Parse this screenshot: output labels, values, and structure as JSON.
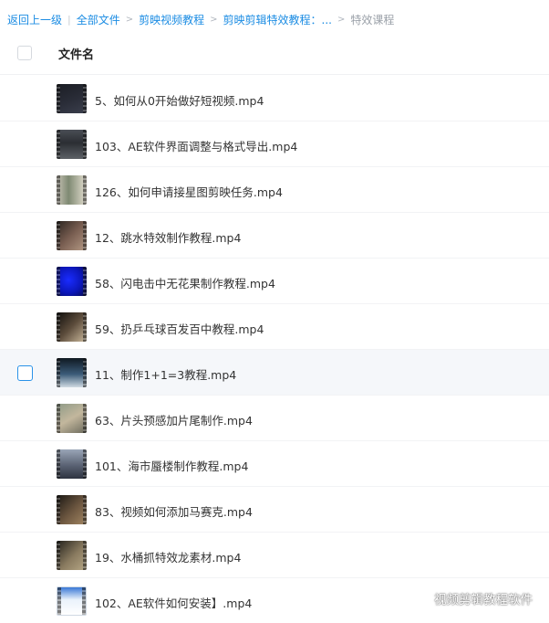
{
  "breadcrumb": {
    "back": "返回上一级",
    "items": [
      "全部文件",
      "剪映视频教程",
      "剪映剪辑特效教程：..."
    ],
    "current": "特效课程"
  },
  "header": {
    "column_label": "文件名"
  },
  "files": [
    {
      "name": "5、如何从0开始做好短视频.mp4"
    },
    {
      "name": "103、AE软件界面调整与格式导出.mp4"
    },
    {
      "name": "126、如何申请接星图剪映任务.mp4"
    },
    {
      "name": "12、跳水特效制作教程.mp4"
    },
    {
      "name": "58、闪电击中无花果制作教程.mp4"
    },
    {
      "name": "59、扔乒乓球百发百中教程.mp4"
    },
    {
      "name": "11、制作1+1=3教程.mp4"
    },
    {
      "name": "63、片头预感加片尾制作.mp4"
    },
    {
      "name": "101、海市蜃楼制作教程.mp4"
    },
    {
      "name": "83、视频如何添加马赛克.mp4"
    },
    {
      "name": "19、水桶抓特效龙素材.mp4"
    },
    {
      "name": "102、AE软件如何安装】.mp4"
    }
  ],
  "watermark": {
    "text": "视频剪辑教程软件",
    "icon": "wechat-icon"
  },
  "colors": {
    "link": "#1b8ce3",
    "hover_row": "#f5f7fa",
    "checkbox_active": "#2a92e8"
  }
}
